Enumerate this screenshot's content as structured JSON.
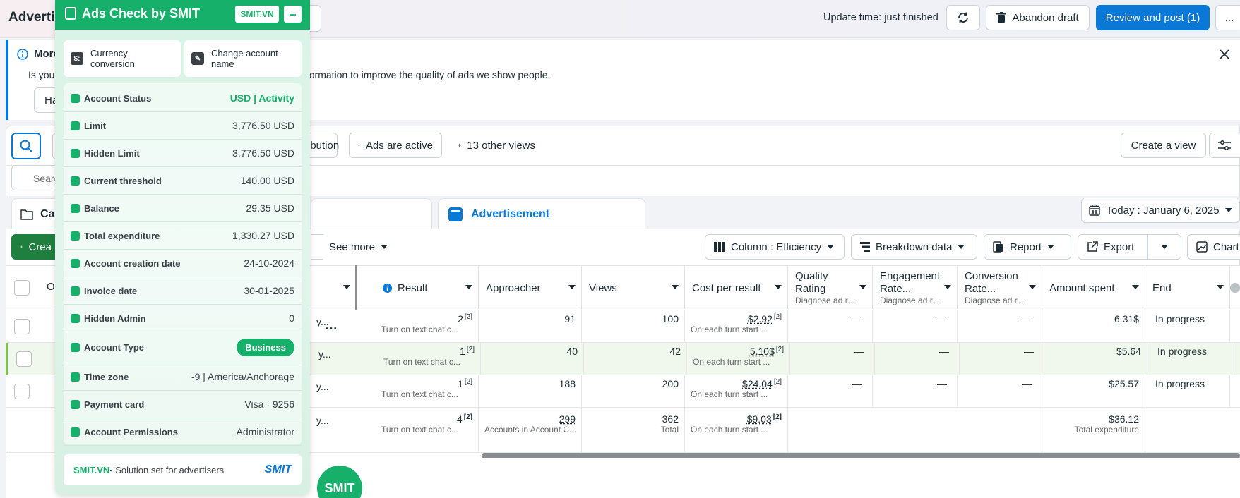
{
  "header": {
    "title": "Advertisement",
    "update_time": "Update time: just finished",
    "abandon_label": "Abandon draft",
    "review_label": "Review and post (1)",
    "more_label": "..."
  },
  "notice": {
    "title": "More",
    "body": "Is your ad about issues of national importance? We'll use this information to improve the quality of ads we show people.",
    "button": "Ha"
  },
  "views": {
    "search_placeholder": "Search",
    "chip_distribution": "ibution",
    "chip_active": "Ads are active",
    "chip_other": "13 other views",
    "create_view": "Create a view"
  },
  "tabs": {
    "campaign": "Ca",
    "advertisement": "Advertisement"
  },
  "date_label": "Today : January 6, 2025",
  "toolbar": {
    "create": "Crea",
    "see_more": "See more",
    "column": "Column : Efficiency",
    "breakdown": "Breakdown data",
    "report": "Report",
    "export": "Export",
    "chart": "Chart"
  },
  "table": {
    "col_o": "O",
    "headers": {
      "result": "Result",
      "approacher": "Approacher",
      "views": "Views",
      "cost": "Cost per result",
      "quality": "Quality Rating",
      "quality_sub": "Diagnose ad r...",
      "engagement": "Engagement Rate...",
      "engagement_sub": "Diagnose ad r...",
      "conversion": "Conversion Rate...",
      "conversion_sub": "Diagnose ad r...",
      "amount": "Amount spent",
      "end": "End"
    },
    "rows": [
      {
        "name_tail": "y...",
        "result": "2",
        "result_sup": "[2]",
        "result_sub": "Turn on text chat c...",
        "approacher": "91",
        "views": "100",
        "cost": "$2.92",
        "cost_sup": "[2]",
        "cost_sub": "On each turn start ...",
        "quality": "—",
        "engagement": "—",
        "conversion": "—",
        "amount": "6.31$",
        "end": "In progress"
      },
      {
        "name_tail": "y...",
        "result": "1",
        "result_sup": "[2]",
        "result_sub": "Turn on text chat c...",
        "approacher": "40",
        "views": "42",
        "cost": "5.10$",
        "cost_sup": "[2]",
        "cost_sub": "On each turn start ...",
        "quality": "—",
        "engagement": "—",
        "conversion": "—",
        "amount": "$5.64",
        "end": "In progress"
      },
      {
        "name_tail": "y...",
        "result": "1",
        "result_sup": "[2]",
        "result_sub": "Turn on text chat c...",
        "approacher": "188",
        "views": "200",
        "cost": "$24.04",
        "cost_sup": "[2]",
        "cost_sub": "On each turn start ...",
        "quality": "—",
        "engagement": "—",
        "conversion": "—",
        "amount": "$25.57",
        "end": "In progress"
      }
    ],
    "totals": {
      "name_tail": "y...",
      "result": "4",
      "result_sup": "[2]",
      "result_sub": "Turn on text chat c...",
      "approacher": "299",
      "approacher_sub": "Accounts in Account C...",
      "views": "362",
      "views_sub": "Total",
      "cost": "$9.03",
      "cost_sup": "[2]",
      "cost_sub": "On each turn start ...",
      "amount": "$36.12",
      "amount_sub": "Total expenditure"
    }
  },
  "overlay": {
    "title": "Ads Check by SMIT",
    "badge": "SMIT.VN",
    "minimize": "–",
    "currency_conversion": "Currency conversion",
    "change_account_name": "Change account name",
    "rows": [
      {
        "label": "Account Status",
        "value": "USD | Activity"
      },
      {
        "label": "Limit",
        "value": "3,776.50 USD"
      },
      {
        "label": "Hidden Limit",
        "value": "3,776.50 USD"
      },
      {
        "label": "Current threshold",
        "value": "140.00 USD"
      },
      {
        "label": "Balance",
        "value": "29.35 USD"
      },
      {
        "label": "Total expenditure",
        "value": "1,330.27 USD"
      },
      {
        "label": "Account creation date",
        "value": "24-10-2024"
      },
      {
        "label": "Invoice date",
        "value": "30-01-2025"
      },
      {
        "label": "Hidden Admin",
        "value": "0"
      },
      {
        "label": "Account Type",
        "value": "Business"
      },
      {
        "label": "Time zone",
        "value": "-9 | America/Anchorage"
      },
      {
        "label": "Payment card",
        "value": "Visa · 9256"
      },
      {
        "label": "Account Permissions",
        "value": "Administrator"
      }
    ],
    "footer_brand": "SMIT.VN",
    "footer_text": " - Solution set for advertisers",
    "footer_logo": "SMIT",
    "fab_label": "SMIT"
  },
  "colors": {
    "accent": "#0a78d6",
    "smit_green": "#16b06b"
  }
}
